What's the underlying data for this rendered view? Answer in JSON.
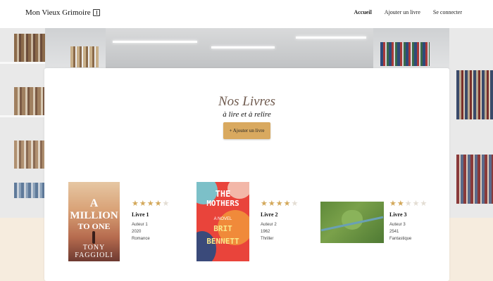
{
  "header": {
    "logo_text": "Mon Vieux Grimoire",
    "nav": [
      {
        "label": "Accueil",
        "active": true
      },
      {
        "label": "Ajouter un livre",
        "active": false
      },
      {
        "label": "Se connecter",
        "active": false
      }
    ]
  },
  "main": {
    "title": "Nos Livres",
    "subtitle": "à lire et à relire",
    "add_button": "+ Ajouter un livre"
  },
  "books": [
    {
      "title": "Livre 1",
      "author": "Auteur 1",
      "year": "2020",
      "genre": "Romance",
      "rating": 4,
      "cover": {
        "lines": [
          "A",
          "MILLION",
          "TO ONE",
          "TONY",
          "FAGGIOLI"
        ]
      }
    },
    {
      "title": "Livre 2",
      "author": "Auteur 2",
      "year": "1962",
      "genre": "Thriller",
      "rating": 4,
      "cover": {
        "lines": [
          "THE",
          "MOTHERS",
          "A NOVEL",
          "BRIT",
          "BENNETT"
        ]
      }
    },
    {
      "title": "Livre 3",
      "author": "Auteur 3",
      "year": "2541",
      "genre": "Fantastique",
      "rating": 2,
      "cover": {
        "lines": []
      }
    }
  ],
  "colors": {
    "accent": "#d9a95f",
    "title": "#6f5a4e",
    "star_on": "#d3a85a",
    "star_off": "#e3ddd3"
  },
  "icons": {
    "logo": "book-icon",
    "rating": "star-icon"
  }
}
